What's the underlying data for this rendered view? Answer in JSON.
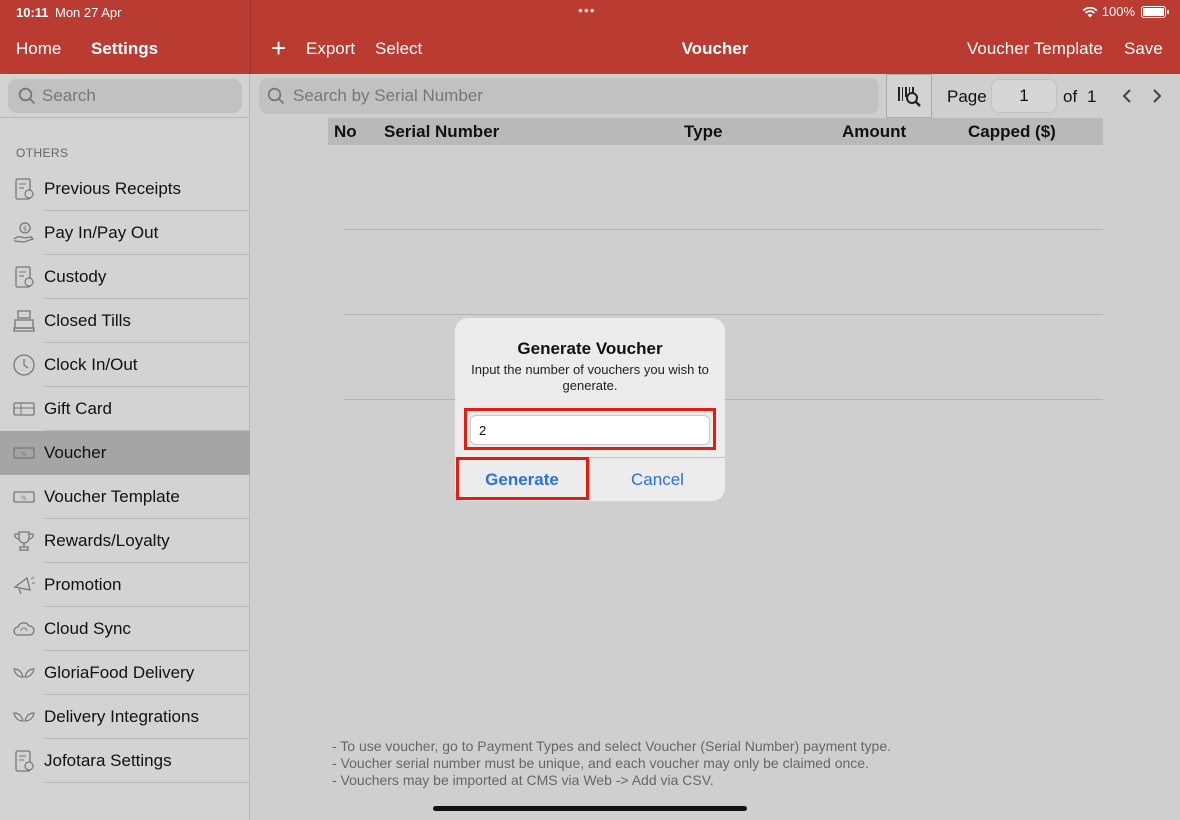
{
  "status": {
    "time": "10:11",
    "date": "Mon 27 Apr",
    "battery": "100%"
  },
  "nav": {
    "home": "Home",
    "settings": "Settings",
    "export": "Export",
    "select": "Select",
    "title": "Voucher",
    "voucher_template": "Voucher Template",
    "save": "Save"
  },
  "sidebar": {
    "search_placeholder": "Search",
    "section": "OTHERS",
    "items": [
      {
        "label": "Previous Receipts",
        "icon": "receipt-icon"
      },
      {
        "label": "Pay In/Pay Out",
        "icon": "money-hand-icon"
      },
      {
        "label": "Custody",
        "icon": "receipt-icon"
      },
      {
        "label": "Closed Tills",
        "icon": "cash-register-icon"
      },
      {
        "label": "Clock In/Out",
        "icon": "clock-icon"
      },
      {
        "label": "Gift Card",
        "icon": "gift-card-icon"
      },
      {
        "label": "Voucher",
        "icon": "voucher-icon",
        "active": true
      },
      {
        "label": "Voucher Template",
        "icon": "voucher-template-icon"
      },
      {
        "label": "Rewards/Loyalty",
        "icon": "trophy-icon"
      },
      {
        "label": "Promotion",
        "icon": "megaphone-icon"
      },
      {
        "label": "Cloud Sync",
        "icon": "cloud-sync-icon"
      },
      {
        "label": "GloriaFood Delivery",
        "icon": "leaf-icon"
      },
      {
        "label": "Delivery Integrations",
        "icon": "leaf-icon"
      },
      {
        "label": "Jofotara Settings",
        "icon": "receipt-icon"
      }
    ]
  },
  "main": {
    "search_placeholder": "Search by Serial Number",
    "page_label": "Page",
    "page_value": "1",
    "page_of": "of",
    "page_total": "1",
    "columns": [
      "No",
      "Serial Number",
      "Type",
      "Amount",
      "Capped ($)"
    ],
    "footnotes": [
      "- To use voucher, go to Payment Types and select Voucher (Serial Number) payment type.",
      "- Voucher serial number must be unique, and each voucher may only be claimed once.",
      "- Vouchers may be imported at CMS via Web -> Add via CSV."
    ]
  },
  "dialog": {
    "title": "Generate Voucher",
    "message": "Input the number of vouchers you wish to generate.",
    "input_value": "2",
    "generate": "Generate",
    "cancel": "Cancel"
  }
}
